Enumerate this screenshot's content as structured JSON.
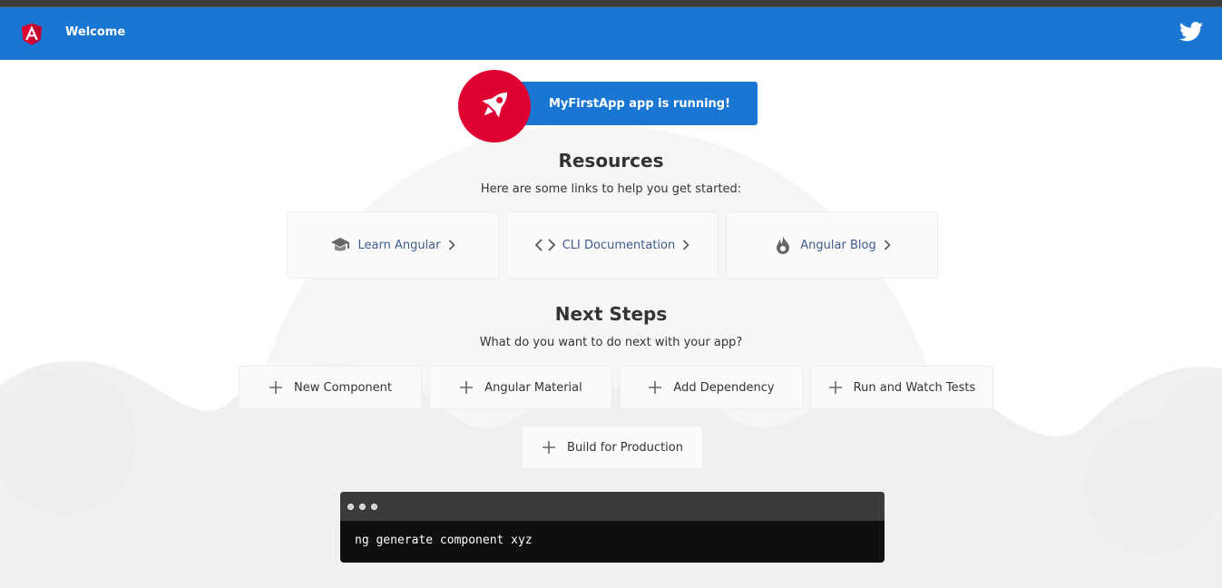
{
  "toolbar": {
    "title": "Welcome",
    "logo_icon": "angular-logo-icon",
    "twitter_icon": "twitter-icon",
    "background": "#1976d2"
  },
  "highlight": {
    "text": "MyFirstApp app is running!",
    "icon": "rocket-icon",
    "accent": "#dd0031"
  },
  "resources": {
    "title": "Resources",
    "subtitle": "Here are some links to help you get started:",
    "cards": [
      {
        "label": "Learn Angular",
        "icon": "graduation-cap-icon"
      },
      {
        "label": "CLI Documentation",
        "icon": "code-brackets-icon"
      },
      {
        "label": "Angular Blog",
        "icon": "flame-icon"
      }
    ]
  },
  "next_steps": {
    "title": "Next Steps",
    "subtitle": "What do you want to do next with your app?",
    "cards": [
      {
        "label": "New Component"
      },
      {
        "label": "Angular Material"
      },
      {
        "label": "Add Dependency"
      },
      {
        "label": "Run and Watch Tests"
      },
      {
        "label": "Build for Production"
      }
    ]
  },
  "terminal": {
    "command": "ng generate component xyz"
  }
}
